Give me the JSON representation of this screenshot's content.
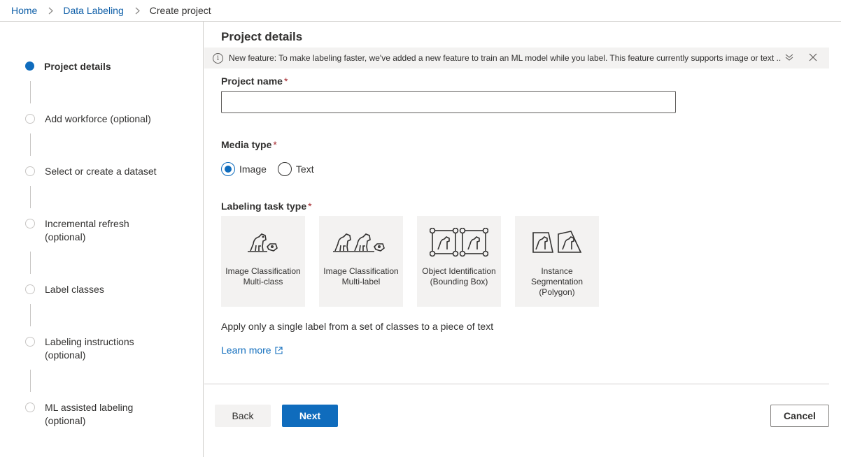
{
  "breadcrumb": {
    "home": "Home",
    "data_labeling": "Data Labeling",
    "current": "Create project"
  },
  "steps": [
    {
      "label": "Project details",
      "active": true
    },
    {
      "label": "Add workforce (optional)",
      "active": false
    },
    {
      "label": "Select or create a dataset",
      "active": false
    },
    {
      "label": "Incremental refresh (optional)",
      "active": false
    },
    {
      "label": "Label classes",
      "active": false
    },
    {
      "label": "Labeling instructions (optional)",
      "active": false
    },
    {
      "label": "ML assisted labeling (optional)",
      "active": false
    }
  ],
  "main": {
    "title": "Project details",
    "banner": {
      "prefix": "New feature:",
      "message": " To make labeling faster, we've added a new feature to train an ML model while you label. This feature currently supports image or text ..."
    },
    "project_name": {
      "label": "Project name",
      "required_mark": "*",
      "value": "",
      "placeholder": ""
    },
    "media_type": {
      "label": "Media type",
      "required_mark": "*",
      "options": [
        {
          "label": "Image",
          "checked": true
        },
        {
          "label": "Text",
          "checked": false
        }
      ]
    },
    "task_type": {
      "label": "Labeling task type",
      "required_mark": "*",
      "tiles": [
        {
          "label": "Image Classification Multi-class",
          "icon": "dog-tag-icon"
        },
        {
          "label": "Image Classification Multi-label",
          "icon": "dogs-tag-icon"
        },
        {
          "label": "Object Identification (Bounding Box)",
          "icon": "bounding-box-icon"
        },
        {
          "label": "Instance Segmentation (Polygon)",
          "icon": "polygon-icon"
        }
      ]
    },
    "description": "Apply only a single label from a set of classes to a piece of text",
    "learn_more": "Learn more"
  },
  "footer": {
    "back": "Back",
    "next": "Next",
    "cancel": "Cancel"
  },
  "colors": {
    "accent": "#0f6cbd",
    "link": "#0f5fa8",
    "required": "#a4262c",
    "tile_bg": "#f3f2f1"
  }
}
